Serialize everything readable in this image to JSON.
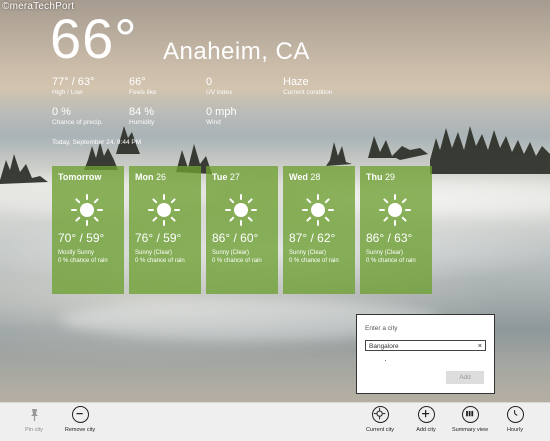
{
  "watermark": "©meraTechPort",
  "current": {
    "temp": "66°",
    "city": "Anaheim, CA",
    "stats": [
      {
        "value": "77° / 63°",
        "label": "High / Low"
      },
      {
        "value": "66°",
        "label": "Feels like"
      },
      {
        "value": "0",
        "label": "UV index"
      },
      {
        "value": "Haze",
        "label": "Current condition"
      },
      {
        "value": "0 %",
        "label": "Chance of precip."
      },
      {
        "value": "84 %",
        "label": "Humidity"
      },
      {
        "value": "0 mph",
        "label": "Wind"
      }
    ],
    "date": "Today, September 24, 9:44 PM"
  },
  "forecast": [
    {
      "day": "Tomorrow",
      "date": "",
      "icon": "sun-icon",
      "temps": "70° / 59°",
      "condition": "Mostly Sunny",
      "rain": "0 % chance of rain"
    },
    {
      "day": "Mon",
      "date": "26",
      "icon": "sun-icon",
      "temps": "76° / 59°",
      "condition": "Sunny (Clear)",
      "rain": "0 % chance of rain"
    },
    {
      "day": "Tue",
      "date": "27",
      "icon": "sun-icon",
      "temps": "86° / 60°",
      "condition": "Sunny (Clear)",
      "rain": "0 % chance of rain"
    },
    {
      "day": "Wed",
      "date": "28",
      "icon": "sun-icon",
      "temps": "87° / 62°",
      "condition": "Sunny (Clear)",
      "rain": "0 % chance of rain"
    },
    {
      "day": "Thu",
      "date": "29",
      "icon": "sun-icon",
      "temps": "86° / 63°",
      "condition": "Sunny (Clear)",
      "rain": "0 % chance of rain"
    }
  ],
  "dialog": {
    "title": "Enter a city",
    "value": "Bangalore",
    "clear_glyph": "×",
    "add_label": "Add"
  },
  "appbar": {
    "left": [
      {
        "label": "Pin city",
        "icon": "pin-icon",
        "enabled": false
      },
      {
        "label": "Remove city",
        "icon": "remove-icon",
        "enabled": true
      }
    ],
    "right": [
      {
        "label": "Current city",
        "icon": "target-icon"
      },
      {
        "label": "Add city",
        "icon": "add-icon"
      },
      {
        "label": "Summary view",
        "icon": "summary-view-icon"
      },
      {
        "label": "Hourly",
        "icon": "clock-icon"
      }
    ]
  },
  "colors": {
    "tile": "#6ea032",
    "appbar": "#efefef",
    "dialog_border": "#333333"
  }
}
